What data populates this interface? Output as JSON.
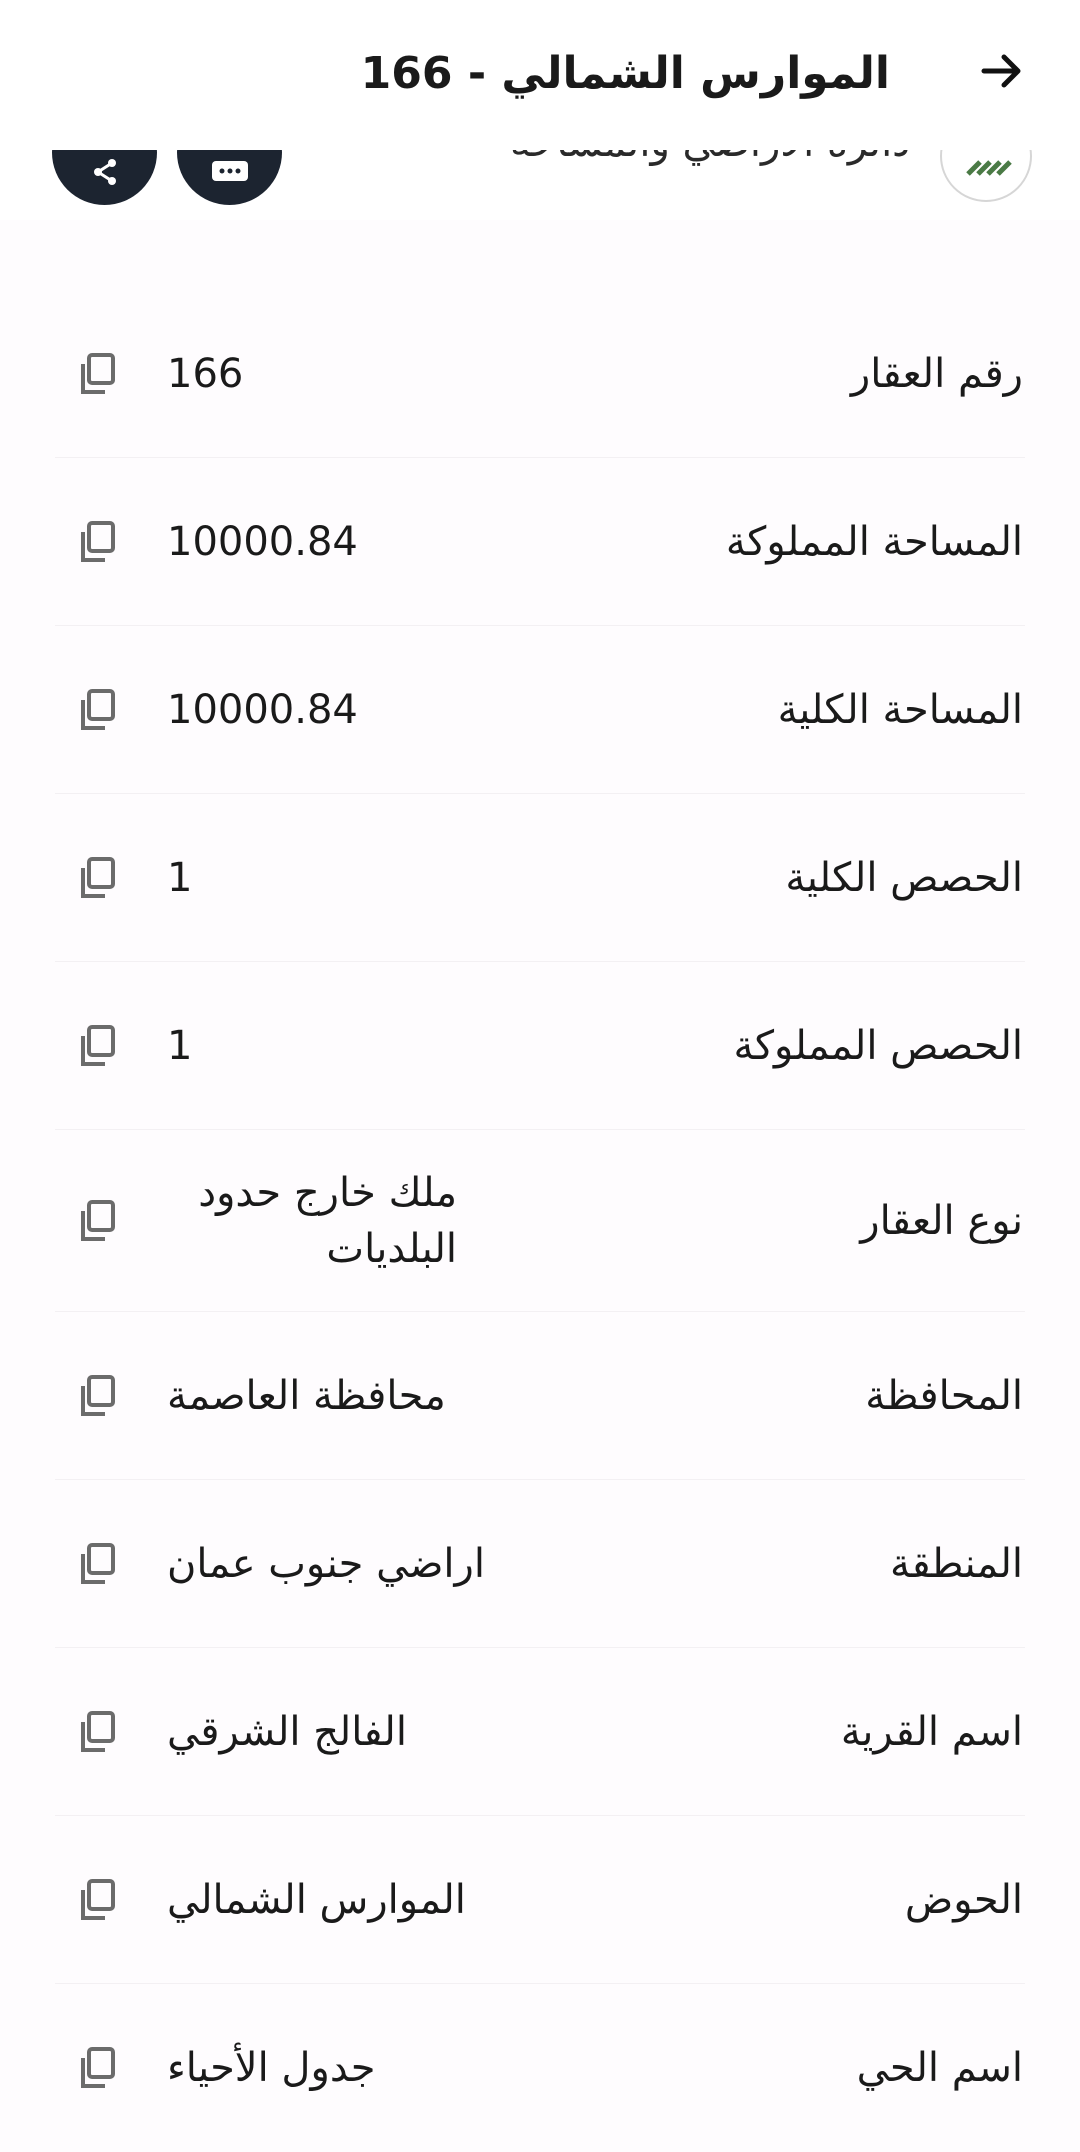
{
  "header": {
    "title_text": "الموارس الشمالي",
    "title_sep": " - ",
    "title_num": "166",
    "back_icon": "arrow-right-icon"
  },
  "subheader": {
    "department": "دائرة الأراضي والمساحة",
    "share_icon": "share-icon",
    "chat_icon": "chat-icon"
  },
  "fields": [
    {
      "label": "رقم العقار",
      "value": "166"
    },
    {
      "label": "المساحة المملوكة",
      "value": "10000.84"
    },
    {
      "label": "المساحة الكلية",
      "value": "10000.84"
    },
    {
      "label": "الحصص الكلية",
      "value": "1"
    },
    {
      "label": "الحصص المملوكة",
      "value": "1"
    },
    {
      "label": "نوع العقار",
      "value": "ملك خارج حدود البلديات"
    },
    {
      "label": "المحافظة",
      "value": "محافظة العاصمة"
    },
    {
      "label": "المنطقة",
      "value": "اراضي جنوب عمان"
    },
    {
      "label": "اسم القرية",
      "value": "الفالج الشرقي"
    },
    {
      "label": "الحوض",
      "value": "الموارس الشمالي"
    },
    {
      "label": "اسم الحي",
      "value": "جدول الأحياء"
    }
  ],
  "colors": {
    "fab": "#1c2430",
    "background": "#fefcfe",
    "icon_gray": "#6b6b6b"
  }
}
